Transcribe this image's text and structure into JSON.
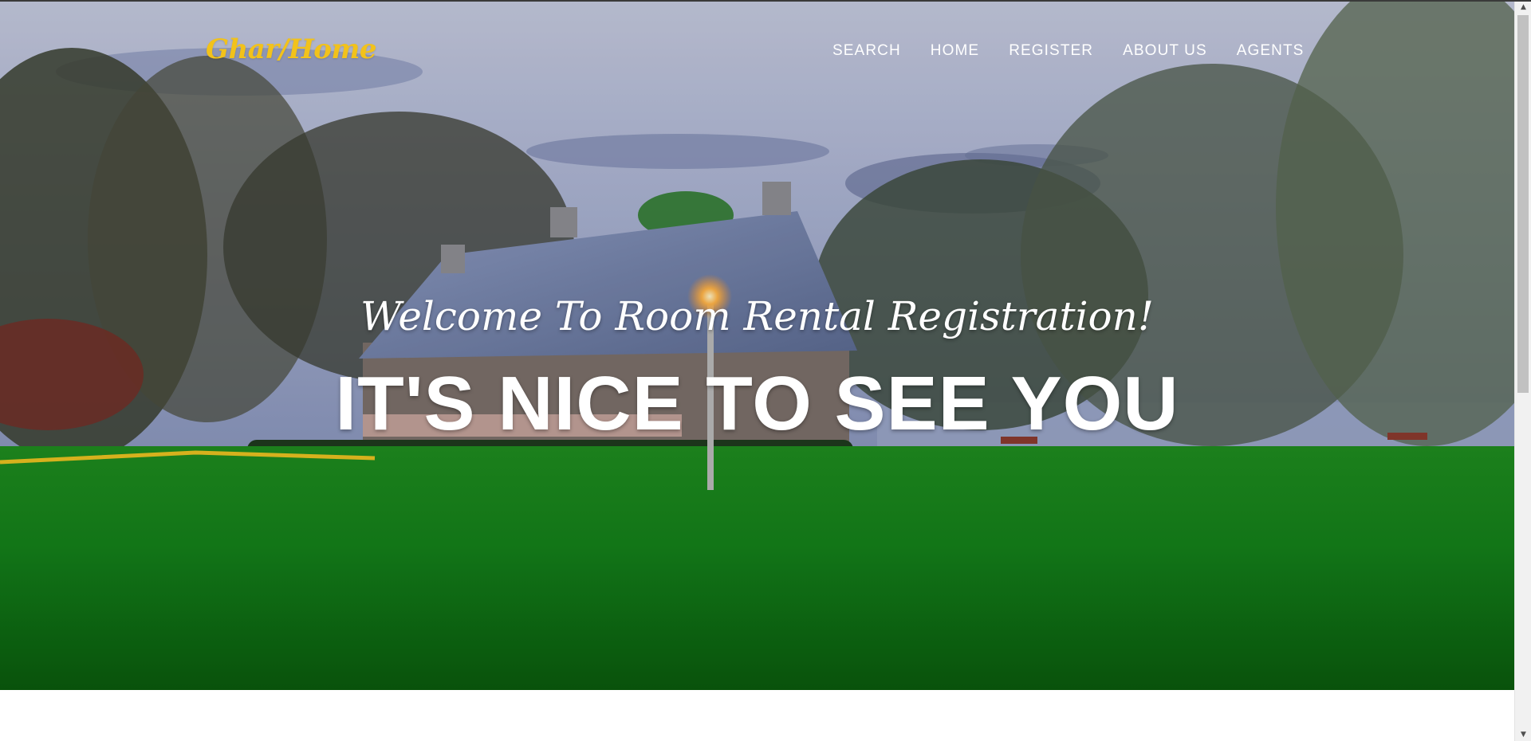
{
  "brand": {
    "name": "Ghar/Home",
    "color": "#f2c21b"
  },
  "nav": {
    "items": [
      {
        "label": "SEARCH"
      },
      {
        "label": "HOME"
      },
      {
        "label": "REGISTER"
      },
      {
        "label": "ABOUT US"
      },
      {
        "label": "AGENTS"
      }
    ]
  },
  "hero": {
    "welcome": "Welcome To Room Rental Registration!",
    "headline": "IT'S NICE TO SEE YOU",
    "background_description_icon": "house-lawn-photo"
  },
  "scrollbar": {
    "up_icon": "▲",
    "down_icon": "▼"
  }
}
